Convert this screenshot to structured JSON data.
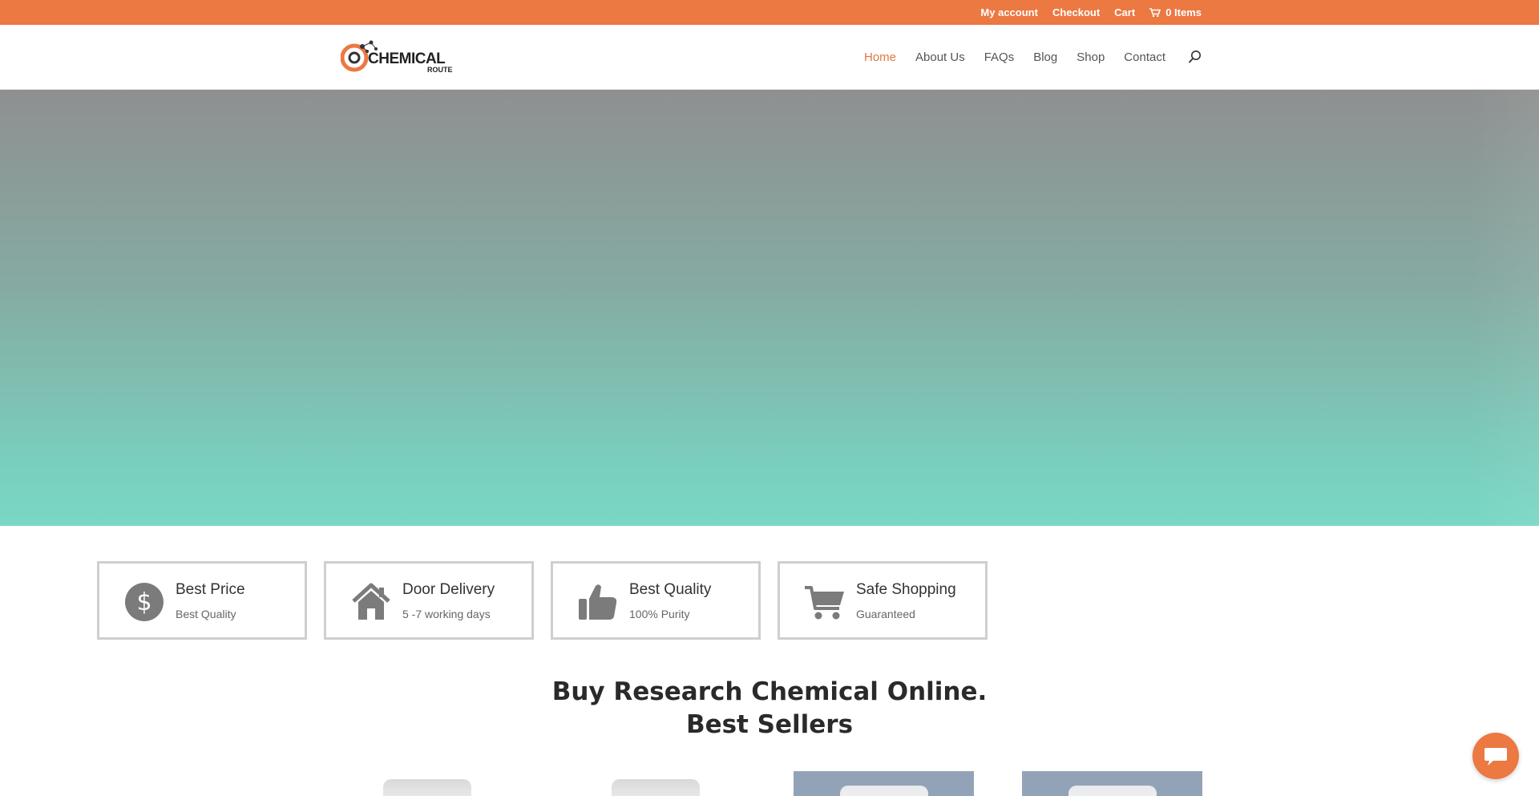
{
  "topbar": {
    "links": [
      "My account",
      "Checkout",
      "Cart"
    ],
    "cart_count": "0 Items",
    "bg_color": "#ec7842"
  },
  "logo": {
    "main_text": "CHEMICAL",
    "sub_text": "ROUTE"
  },
  "nav": {
    "items": [
      "Home",
      "About Us",
      "FAQs",
      "Blog",
      "Shop",
      "Contact"
    ],
    "active": "Home",
    "active_color": "#e0773f",
    "search_icon": "search-icon"
  },
  "hero": {
    "gradient_top": "#8e9090",
    "gradient_bottom": "#79d8c5"
  },
  "features": [
    {
      "icon": "dollar-icon",
      "title": "Best Price",
      "subtitle": "Best Quality"
    },
    {
      "icon": "house-icon",
      "title": "Door Delivery",
      "subtitle": "5 -7 working days"
    },
    {
      "icon": "thumbs-up-icon",
      "title": "Best Quality",
      "subtitle": "100% Purity"
    },
    {
      "icon": "cart-icon",
      "title": "Safe Shopping",
      "subtitle": "Guaranteed"
    }
  ],
  "headline": {
    "line1": "Buy Research Chemical Online.",
    "line2": "Best Sellers"
  },
  "chat": {
    "icon": "chat-icon",
    "color": "#ec7842"
  }
}
